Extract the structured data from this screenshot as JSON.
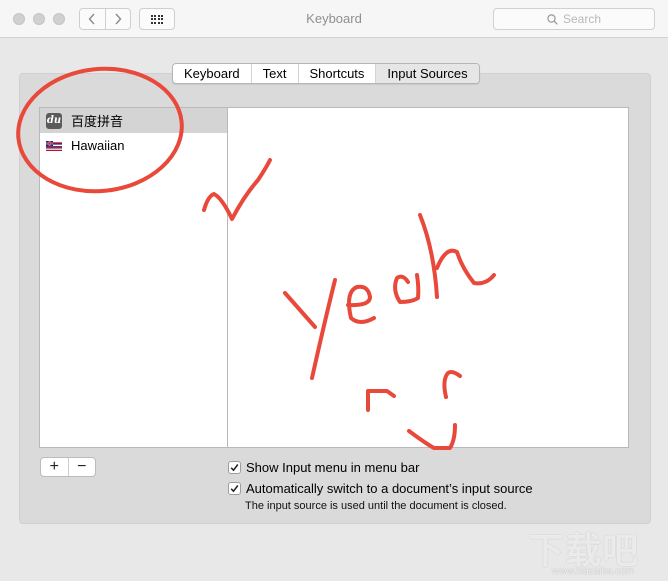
{
  "window": {
    "title": "Keyboard",
    "search_placeholder": "Search"
  },
  "toolbar": {
    "back_icon": "chevron-left-icon",
    "forward_icon": "chevron-right-icon",
    "show_all_icon": "grid-icon"
  },
  "tabs": [
    {
      "label": "Keyboard",
      "active": false
    },
    {
      "label": "Text",
      "active": false
    },
    {
      "label": "Shortcuts",
      "active": false
    },
    {
      "label": "Input Sources",
      "active": true
    }
  ],
  "input_sources": [
    {
      "label": "百度拼音",
      "icon": "baidu-du-icon",
      "selected": true
    },
    {
      "label": "Hawaiian",
      "icon": "hawaii-flag-icon",
      "selected": false
    }
  ],
  "list_controls": {
    "add": "+",
    "remove": "−"
  },
  "options": [
    {
      "label": "Show Input menu in menu bar",
      "checked": true
    },
    {
      "label": "Automatically switch to a document’s input source",
      "checked": true
    }
  ],
  "note": "The input source is used until the document is closed.",
  "annotations": {
    "color": "#e8493a",
    "text": "yeah",
    "shapes": [
      "circle-around-list",
      "checkmark",
      "smiley-face"
    ]
  },
  "watermark": {
    "text": "下载吧",
    "url": "www.xiazaiba.com"
  }
}
